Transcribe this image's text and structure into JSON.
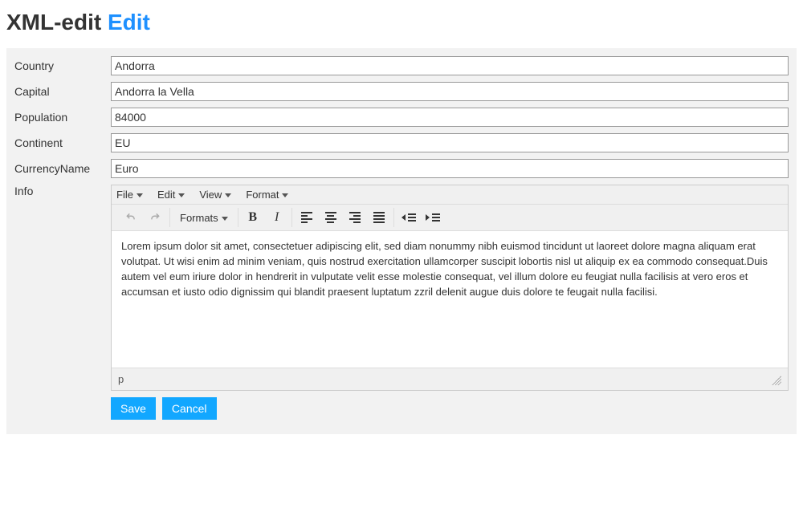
{
  "header": {
    "title_main": "XML-edit",
    "title_accent": "Edit"
  },
  "form": {
    "country": {
      "label": "Country",
      "value": "Andorra"
    },
    "capital": {
      "label": "Capital",
      "value": "Andorra la Vella"
    },
    "population": {
      "label": "Population",
      "value": "84000"
    },
    "continent": {
      "label": "Continent",
      "value": "EU"
    },
    "currency_name": {
      "label": "CurrencyName",
      "value": "Euro"
    },
    "info": {
      "label": "Info"
    }
  },
  "rte": {
    "menu": {
      "file": "File",
      "edit": "Edit",
      "view": "View",
      "format": "Format"
    },
    "toolbar": {
      "formats": "Formats"
    },
    "content": "Lorem ipsum dolor sit amet, consectetuer adipiscing elit, sed diam nonummy nibh euismod tincidunt ut laoreet dolore magna aliquam erat volutpat. Ut wisi enim ad minim veniam, quis nostrud exercitation ullamcorper suscipit lobortis nisl ut aliquip ex ea commodo consequat.Duis autem vel eum iriure dolor in hendrerit in vulputate velit esse molestie consequat, vel illum dolore eu feugiat nulla facilisis at vero eros et accumsan et iusto odio dignissim qui blandit praesent luptatum zzril delenit augue duis dolore te feugait nulla facilisi.",
    "status_path": "p"
  },
  "buttons": {
    "save": "Save",
    "cancel": "Cancel"
  }
}
